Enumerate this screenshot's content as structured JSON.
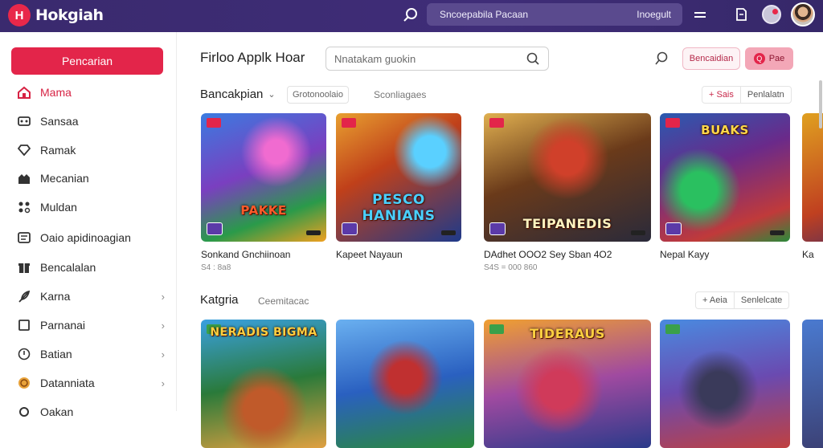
{
  "app": {
    "logo_text": "Hokgiah",
    "logo_mark": "H"
  },
  "topbar": {
    "search_value": "Sncoepabila Pacaan",
    "search_action": "Inoegult",
    "icons": [
      "search-icon",
      "menu-icon",
      "document-icon",
      "notification-icon",
      "avatar"
    ]
  },
  "sidebar": {
    "primary_button": "Pencarian",
    "items": [
      {
        "label": "Mama",
        "icon": "home-icon",
        "active": true
      },
      {
        "label": "Sansaa",
        "icon": "gamepad-icon"
      },
      {
        "label": "Ramak",
        "icon": "heart-icon"
      },
      {
        "label": "Mecanian",
        "icon": "store-icon"
      },
      {
        "label": "Muldan",
        "icon": "users-icon"
      },
      {
        "label": "Oaio apidinoagian",
        "icon": "list-icon"
      },
      {
        "label": "Bencalalan",
        "icon": "gift-icon"
      },
      {
        "label": "Karna",
        "icon": "feather-icon",
        "chevron": "›"
      },
      {
        "label": "Parnanai",
        "icon": "square-icon",
        "chevron": "›"
      },
      {
        "label": "Batian",
        "icon": "face-icon",
        "chevron": "›"
      },
      {
        "label": "Datanniata",
        "icon": "coin-icon",
        "chevron": "›"
      },
      {
        "label": "Oakan",
        "icon": "settings-icon"
      }
    ]
  },
  "header": {
    "title": "Firloo Applk Hoar",
    "search_placeholder": "Nnatakam guokin",
    "btn_outline": "Bencaidian",
    "btn_filled": "Pae",
    "btn_filled_icon": "Q"
  },
  "section1": {
    "title": "Bancakpian",
    "chip": "Grotonoolaio",
    "link": "Sconliagaes",
    "seg_left": "+ Sais",
    "seg_right": "Penlalatn",
    "cards": [
      {
        "name": "Sonkand Gnchiinoan",
        "meta": "S4 : 8a8",
        "art": "PAKKE"
      },
      {
        "name": "Kapeet Nayaun",
        "meta": "",
        "art": "PESCO HANIANS"
      },
      {
        "name": "DAdhet OOO2 Sey Sban 4O2",
        "meta": "S4S = 000 860",
        "art": "TEIPANEDIS"
      },
      {
        "name": "Nepal Kayy",
        "meta": "",
        "art": "BUAKS"
      },
      {
        "name": "Ka",
        "meta": "",
        "art": ""
      }
    ]
  },
  "section2": {
    "title": "Katgria",
    "link": "Ceemitacac",
    "seg_left": "+ Aeia",
    "seg_right": "Senlelcate",
    "cards": [
      {
        "art": "NERADIS BIGMA"
      },
      {
        "art": ""
      },
      {
        "art": "TIDERAUS"
      },
      {
        "art": ""
      },
      {
        "art": ""
      }
    ]
  },
  "colors": {
    "topbar": "#3f2d78",
    "accent": "#e3254a",
    "pink_soft": "#f3a7b7"
  }
}
